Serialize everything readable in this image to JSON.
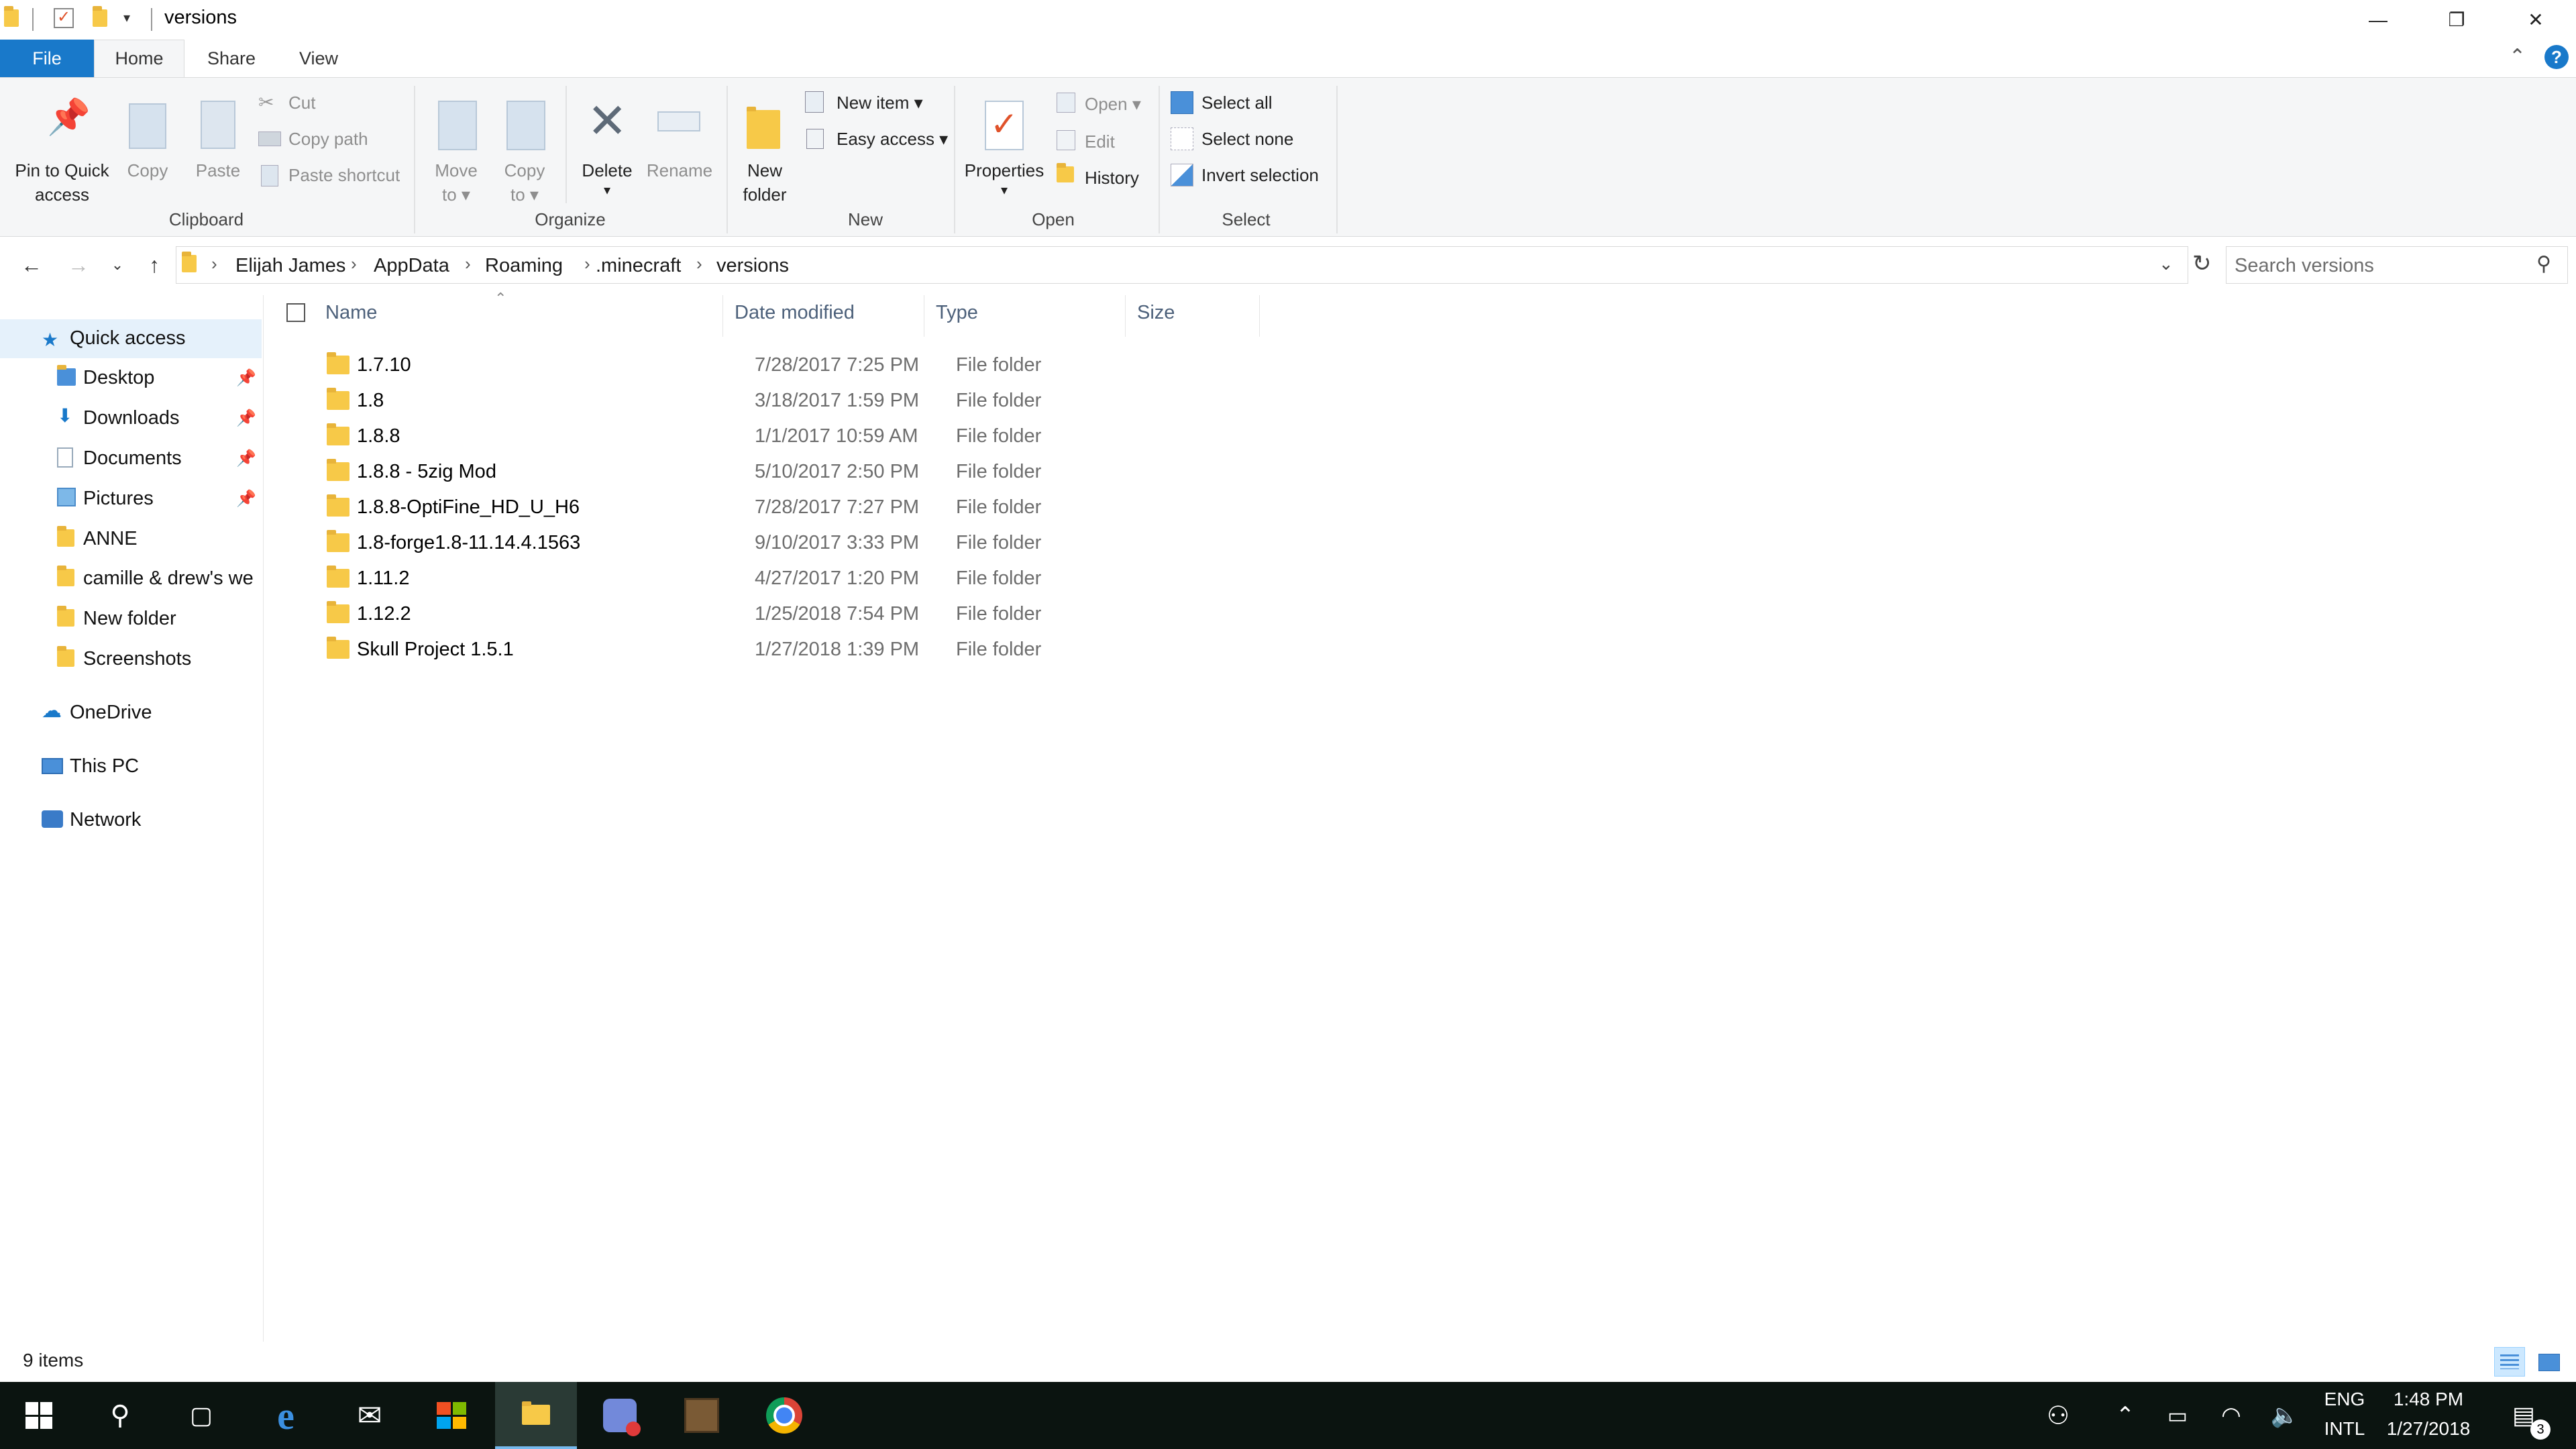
{
  "window": {
    "title": "versions",
    "controls": {
      "minimize": "—",
      "restore": "❐",
      "close": "✕"
    }
  },
  "tabs": {
    "file": "File",
    "home": "Home",
    "share": "Share",
    "view": "View"
  },
  "ribbon": {
    "clipboard": {
      "label": "Clipboard",
      "pin_line1": "Pin to Quick",
      "pin_line2": "access",
      "copy": "Copy",
      "paste": "Paste",
      "cut": "Cut",
      "copy_path": "Copy path",
      "paste_shortcut": "Paste shortcut"
    },
    "organize": {
      "label": "Organize",
      "move_line1": "Move",
      "move_line2": "to ▾",
      "copy_line1": "Copy",
      "copy_line2": "to ▾",
      "delete": "Delete",
      "delete_arrow": "▾",
      "rename": "Rename"
    },
    "new": {
      "label": "New",
      "folder_line1": "New",
      "folder_line2": "folder",
      "new_item": "New item ▾",
      "easy_access": "Easy access ▾"
    },
    "open": {
      "label": "Open",
      "properties": "Properties",
      "properties_arrow": "▾",
      "open": "Open ▾",
      "edit": "Edit",
      "history": "History"
    },
    "select": {
      "label": "Select",
      "select_all": "Select all",
      "select_none": "Select none",
      "invert": "Invert selection"
    }
  },
  "address": {
    "breadcrumbs": [
      "Elijah James",
      "AppData",
      "Roaming",
      ".minecraft",
      "versions"
    ],
    "search_placeholder": "Search versions"
  },
  "navpane": {
    "quick_access": "Quick access",
    "pinned": [
      "Desktop",
      "Downloads",
      "Documents",
      "Pictures"
    ],
    "folders": [
      "ANNE",
      "camille & drew's we",
      "New folder",
      "Screenshots"
    ],
    "onedrive": "OneDrive",
    "this_pc": "This PC",
    "network": "Network"
  },
  "columns": {
    "name": "Name",
    "date": "Date modified",
    "type": "Type",
    "size": "Size"
  },
  "files": [
    {
      "name": "1.7.10",
      "date": "7/28/2017 7:25 PM",
      "type": "File folder"
    },
    {
      "name": "1.8",
      "date": "3/18/2017 1:59 PM",
      "type": "File folder"
    },
    {
      "name": "1.8.8",
      "date": "1/1/2017 10:59 AM",
      "type": "File folder"
    },
    {
      "name": "1.8.8 - 5zig Mod",
      "date": "5/10/2017 2:50 PM",
      "type": "File folder"
    },
    {
      "name": "1.8.8-OptiFine_HD_U_H6",
      "date": "7/28/2017 7:27 PM",
      "type": "File folder"
    },
    {
      "name": "1.8-forge1.8-11.14.4.1563",
      "date": "9/10/2017 3:33 PM",
      "type": "File folder"
    },
    {
      "name": "1.11.2",
      "date": "4/27/2017 1:20 PM",
      "type": "File folder"
    },
    {
      "name": "1.12.2",
      "date": "1/25/2018 7:54 PM",
      "type": "File folder"
    },
    {
      "name": "Skull Project 1.5.1",
      "date": "1/27/2018 1:39 PM",
      "type": "File folder"
    }
  ],
  "status": {
    "count": "9 items"
  },
  "taskbar": {
    "lang_top": "ENG",
    "lang_bottom": "INTL",
    "time": "1:48 PM",
    "date": "1/27/2018",
    "notification_count": "3"
  },
  "colors": {
    "accent": "#1979ca",
    "taskbar": "#0b1410",
    "folder": "#f7c948"
  }
}
